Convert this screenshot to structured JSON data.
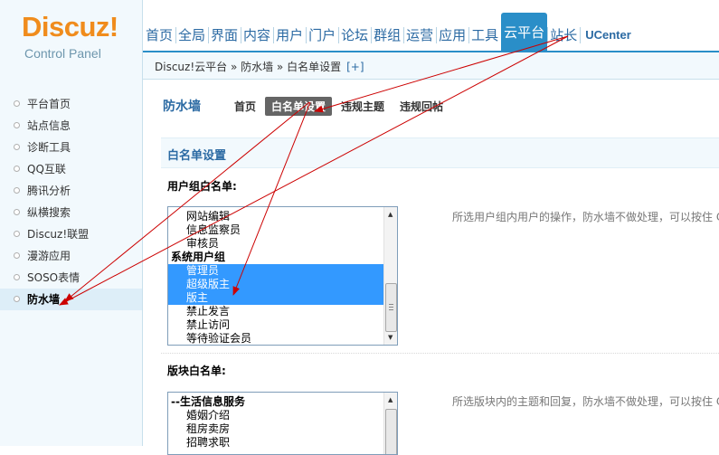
{
  "header": {
    "logo_text": "Discuz!",
    "logo_sub": "Control Panel",
    "nav": [
      {
        "label": "首页"
      },
      {
        "label": "全局"
      },
      {
        "label": "界面"
      },
      {
        "label": "内容"
      },
      {
        "label": "用户"
      },
      {
        "label": "门户"
      },
      {
        "label": "论坛"
      },
      {
        "label": "群组"
      },
      {
        "label": "运营"
      },
      {
        "label": "应用"
      },
      {
        "label": "工具"
      },
      {
        "label": "云平台",
        "active": true
      },
      {
        "label": "站长"
      },
      {
        "label": "UCenter"
      }
    ]
  },
  "breadcrumb": {
    "text": "Discuz!云平台 » 防水墙 » 白名单设置",
    "add": "[+]"
  },
  "sidebar": {
    "items": [
      {
        "label": "平台首页"
      },
      {
        "label": "站点信息"
      },
      {
        "label": "诊断工具"
      },
      {
        "label": "QQ互联"
      },
      {
        "label": "腾讯分析"
      },
      {
        "label": "纵横搜索"
      },
      {
        "label": "Discuz!联盟"
      },
      {
        "label": "漫游应用"
      },
      {
        "label": "SOSO表情"
      },
      {
        "label": "防水墙",
        "active": true
      }
    ]
  },
  "main": {
    "title": "防水墙",
    "tabs": [
      {
        "label": "首页"
      },
      {
        "label": "白名单设置",
        "active": true
      },
      {
        "label": "违规主题"
      },
      {
        "label": "违规回帖"
      }
    ],
    "section_title": "白名单设置",
    "usergroup": {
      "label": "用户组白名单:",
      "options": [
        {
          "text": "网站编辑",
          "type": "opt"
        },
        {
          "text": "信息监察员",
          "type": "opt"
        },
        {
          "text": "审核员",
          "type": "opt"
        },
        {
          "text": "系统用户组",
          "type": "group"
        },
        {
          "text": "管理员",
          "type": "opt",
          "selected": true
        },
        {
          "text": "超级版主",
          "type": "opt",
          "selected": true
        },
        {
          "text": "版主",
          "type": "opt",
          "selected": true
        },
        {
          "text": "禁止发言",
          "type": "opt"
        },
        {
          "text": "禁止访问",
          "type": "opt"
        },
        {
          "text": "等待验证会员",
          "type": "opt"
        }
      ],
      "tip": "所选用户组内用户的操作，防水墙不做处理，可以按住 C"
    },
    "block": {
      "label": "版块白名单:",
      "options": [
        {
          "text": "--生活信息服务",
          "type": "group"
        },
        {
          "text": "婚姻介绍",
          "type": "opt"
        },
        {
          "text": "租房卖房",
          "type": "opt"
        },
        {
          "text": "招聘求职",
          "type": "opt"
        }
      ],
      "tip": "所选版块内的主题和回复，防水墙不做处理，可以按住 C"
    }
  },
  "colors": {
    "accent": "#2a8ec8",
    "selection": "#3399ff",
    "logo": "#f08c1c",
    "annotation": "#cc0000"
  }
}
